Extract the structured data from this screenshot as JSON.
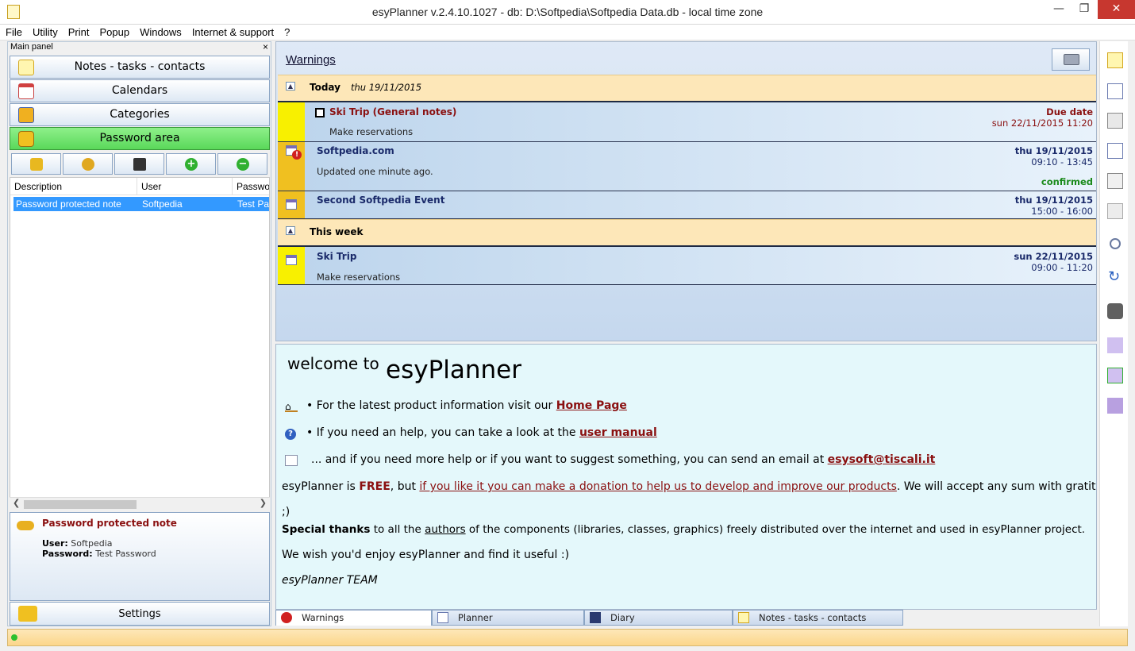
{
  "window": {
    "title": "esyPlanner v.2.4.10.1027 - db: D:\\Softpedia\\Softpedia Data.db - local time zone"
  },
  "menu": [
    "File",
    "Utility",
    "Print",
    "Popup",
    "Windows",
    "Internet & support",
    "?"
  ],
  "left_panel": {
    "header": "Main panel",
    "close": "×",
    "nav": [
      "Notes  -  tasks  -  contacts",
      "Calendars",
      "Categories",
      "Password area"
    ],
    "columns": [
      "Description",
      "User",
      "Passwo"
    ],
    "rows": [
      {
        "description": "Password protected note",
        "user": "Softpedia",
        "password": "Test Pa"
      }
    ],
    "detail": {
      "title": "Password protected note",
      "user_label": "User:",
      "user_value": "Softpedia",
      "password_label": "Password:",
      "password_value": "Test Password"
    },
    "settings": "Settings"
  },
  "warnings": {
    "title": "Warnings",
    "groups": {
      "today": {
        "label": "Today",
        "date": "thu 19/11/2015"
      },
      "week": {
        "label": "This week"
      }
    },
    "items": [
      {
        "title": "Ski Trip (General notes)",
        "sub": "Make reservations",
        "right1": "Due date",
        "right2": "sun 22/11/2015 11:20"
      },
      {
        "title": "Softpedia.com",
        "sub": "Updated one minute ago.",
        "right1": "thu 19/11/2015",
        "right2": "09:10 - 13:45",
        "status": "confirmed"
      },
      {
        "title": "Second Softpedia Event",
        "right1": "thu 19/11/2015",
        "right2": "15:00 - 16:00"
      },
      {
        "title": "Ski Trip",
        "sub": "Make reservations",
        "right1": "sun 22/11/2015",
        "right2": "09:00 - 11:20"
      }
    ]
  },
  "welcome": {
    "heading_small": "welcome to",
    "heading_big": "esyPlanner",
    "line1_text": "• For the latest product information visit our ",
    "line1_link": "Home Page",
    "line2_text": "• If you need an help, you can take a look at the ",
    "line2_link": "user manual",
    "line3_text": "... and if you need more help or if you want to suggest something, you can send an email at ",
    "line3_link": "esysoft@tiscali.it",
    "donate_pre": "esyPlanner is ",
    "donate_free": "FREE",
    "donate_mid": ", but ",
    "donate_link": "if you like it you can make a donation to help us to develop and improve our products",
    "donate_post": ". We will accept any sum with gratitude",
    "donate_tail": ";)",
    "thanks_bold": "Special thanks",
    "thanks_mid": " to all the ",
    "thanks_link": "authors",
    "thanks_post": " of the components (libraries, classes, graphics) freely distributed over the internet and used in esyPlanner project.",
    "wish": "We wish you'd enjoy esyPlanner and find it useful :)",
    "team": "esyPlanner TEAM"
  },
  "tabs": [
    "Warnings",
    "Planner",
    "Diary",
    "Notes - tasks - contacts"
  ]
}
